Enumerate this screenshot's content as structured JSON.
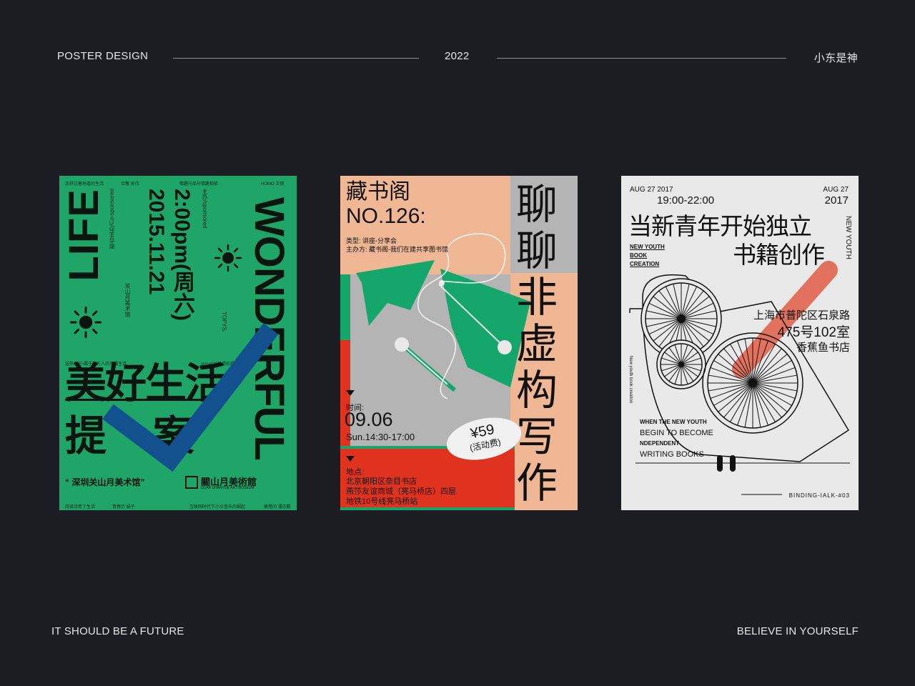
{
  "header": {
    "left": "POSTER DESIGN",
    "center": "2022",
    "right": "小东是神"
  },
  "footer": {
    "left": "IT SHOULD BE A FUTURE",
    "right": "BELIEVE IN YOURSELF"
  },
  "colors": {
    "background": "#1c1d22",
    "poster1_green": "#1ea567",
    "poster1_check": "#12518e",
    "poster2_peach": "#f0b795",
    "poster2_green": "#15a66b",
    "poster2_red": "#df3320",
    "poster2_gray": "#b4b4b4",
    "poster3_bg": "#e9e9ea",
    "poster3_stroke": "#e0533a"
  },
  "poster1": {
    "top_row": [
      "怎样过着地道的生活",
      "合著 吴伟",
      "情趣与品与情趣相依",
      "HOMO 王锐"
    ],
    "bottom_row": [
      "阅读诗意了生活",
      "青春历 娟子",
      "互联网时代下小众音乐的崛起",
      "栗橙间 潘志鹏"
    ],
    "life": "LIFE",
    "date": "2015.11.21",
    "time": "2:00pm(周六)",
    "wonderful": "WONDERFUL",
    "host": "主办/sponsored",
    "cohost": "联合主办/Co-sponsored",
    "venue_short": "关山月美术馆",
    "tops": "TOPYS.",
    "east": "送热东方•属于东方人的幸福生活",
    "since": "since1983 揭松耀的芳香",
    "headline1": "美好生活",
    "headline2": "提    案",
    "venue_quote": "“ 深圳关山月美术馆”",
    "museum_cn": "關山月美術館",
    "museum_en": "GUAN SHANYUE ART MUSEUM"
  },
  "poster2": {
    "title": "藏书阁",
    "number": "NO.126:",
    "type": "类型: 讲座-分享会",
    "host": "主办方: 藏书阁-我们在建共享图书馆",
    "vertical": [
      "聊",
      "聊",
      "非",
      "虚",
      "构",
      "写",
      "作"
    ],
    "time_label": "时间:",
    "date": "09.06",
    "hours": "Sun.14:30-17:00",
    "price": "¥59",
    "fee": "(活动费)",
    "place_label": "地点:",
    "place1": "北京朝阳区奈目书店",
    "place2": "燕莎友谊商城（亮马桥店）四层",
    "place3": "地铁10号线亮马桥站"
  },
  "poster3": {
    "date_left": "AUG 27 2017",
    "time": "19:00-22:00",
    "aug": "AUG 27",
    "year": "2017",
    "title1": "当新青年开始独立",
    "title2": "书籍创作",
    "vertical_en": "NEW YOUTH",
    "small_en": [
      "NEW YOUTH",
      "BOOK",
      "CREATION"
    ],
    "addr1": "上海市普陀区石泉路",
    "addr2": "475号102室",
    "addr3": "香蕉鱼书店",
    "side": "New youth book creation",
    "en_lines": [
      "WHEN THE NEW YOUTH",
      "BEGIN TO BECOME",
      "NDEPENDENT",
      "WRITING BOOKS"
    ],
    "footer": "BINDING-IALK-#03"
  }
}
